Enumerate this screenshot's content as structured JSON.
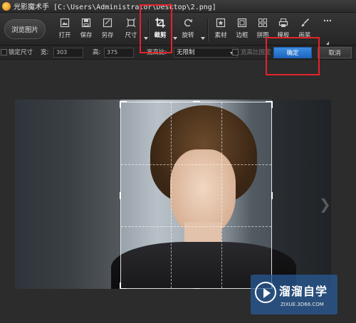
{
  "window": {
    "title": "光影魔术手 [C:\\Users\\Administrator\\Desktop\\2.png]"
  },
  "toolbar": {
    "browse_label": "浏览图片",
    "tools": [
      {
        "name": "open",
        "label": "打开",
        "icon": "open-image-icon"
      },
      {
        "name": "save",
        "label": "保存",
        "icon": "save-icon"
      },
      {
        "name": "save-as",
        "label": "另存",
        "icon": "save-as-icon"
      },
      {
        "name": "size",
        "label": "尺寸",
        "icon": "resize-icon"
      },
      {
        "name": "crop",
        "label": "裁剪",
        "icon": "crop-icon",
        "active": true
      },
      {
        "name": "rotate",
        "label": "旋转",
        "icon": "rotate-icon"
      },
      {
        "name": "material",
        "label": "素材",
        "icon": "star-icon"
      },
      {
        "name": "border",
        "label": "边框",
        "icon": "frame-icon"
      },
      {
        "name": "collage",
        "label": "拼图",
        "icon": "grid-icon"
      },
      {
        "name": "template",
        "label": "模板",
        "icon": "printer-icon"
      },
      {
        "name": "brush",
        "label": "画笔",
        "icon": "brush-icon"
      },
      {
        "name": "more",
        "label": "",
        "icon": "more-icon"
      }
    ]
  },
  "options": {
    "lock_size_label": "锁定尺寸",
    "width_label": "宽:",
    "width_value": "303",
    "height_label": "高:",
    "height_value": "375",
    "ratio_label": "宽高比:",
    "ratio_value": "无限制",
    "lock_ratio_label": "宽高比固定",
    "ok_label": "确定",
    "cancel_label": "取消"
  },
  "watermark": {
    "brand": "溜溜自学",
    "url": "ZIXUE.3D66.COM"
  },
  "colors": {
    "highlight": "#e5232a",
    "ok_button": "#2a78d4"
  }
}
